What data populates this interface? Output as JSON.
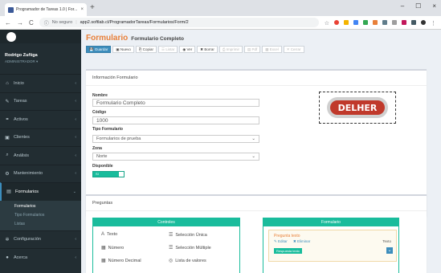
{
  "browser": {
    "tab_title": "Programador de Tareas 1.0 | For...",
    "tab_close": "×",
    "new_tab": "+",
    "window_controls": [
      "–",
      "☐",
      "×"
    ],
    "nav_back": "←",
    "nav_forward": "→",
    "nav_reload": "C",
    "secure_label": "No seguro",
    "url": "app2.softlab.cl/ProgramadorTareas/Formularios/Form/2"
  },
  "sidebar": {
    "user_name": "Rodrigo Zuñiga",
    "user_role": "ADMINISTRADOR ▾",
    "items": [
      {
        "label": "Inicio",
        "icon": "home-icon",
        "glyph": "⌂"
      },
      {
        "label": "Tareas",
        "icon": "wrench-icon",
        "glyph": "✎"
      },
      {
        "label": "Activos",
        "icon": "link-icon",
        "glyph": "⚭"
      },
      {
        "label": "Clientes",
        "icon": "building-icon",
        "glyph": "▣"
      },
      {
        "label": "Análisis",
        "icon": "search-icon",
        "glyph": "⌕"
      },
      {
        "label": "Mantenimiento",
        "icon": "tools-icon",
        "glyph": "⚙"
      },
      {
        "label": "Formularios",
        "icon": "form-icon",
        "glyph": "▤"
      },
      {
        "label": "Configuración",
        "icon": "gear-icon",
        "glyph": "✲"
      },
      {
        "label": "Acerca",
        "icon": "info-icon",
        "glyph": "●"
      }
    ],
    "subitems": [
      "Formularios",
      "Tipo Formularios",
      "Listas"
    ]
  },
  "page": {
    "title": "Formulario",
    "subtitle": "Formulario Completo"
  },
  "toolbar": [
    {
      "label": "Guardar",
      "state": "primary"
    },
    {
      "label": "Nuevo",
      "state": "normal"
    },
    {
      "label": "Copiar",
      "state": "normal"
    },
    {
      "label": "Listar",
      "state": "disabled"
    },
    {
      "label": "Ver",
      "state": "normal"
    },
    {
      "label": "Borrar",
      "state": "normal"
    },
    {
      "label": "Imprimir",
      "state": "disabled"
    },
    {
      "label": "Pdf",
      "state": "disabled"
    },
    {
      "label": "Excel",
      "state": "disabled"
    },
    {
      "label": "Cerrar",
      "state": "disabled"
    }
  ],
  "info_box": {
    "title": "Información Formulario",
    "nombre_label": "Nombre",
    "nombre_value": "Formulario Completo",
    "codigo_label": "Código",
    "codigo_value": "1000",
    "tipo_label": "Tipo Formulario",
    "tipo_value": "Formularios de prueba",
    "zona_label": "Zona",
    "zona_value": "Norte",
    "disponible_label": "Disponible",
    "disponible_value": "SI",
    "logo_text": "DELHER"
  },
  "preguntas_box": {
    "title": "Preguntas",
    "controles_header": "Controles",
    "formulario_header": "Formulario",
    "controls": [
      {
        "label": "Texto",
        "glyph": "A"
      },
      {
        "label": "Selección Única",
        "glyph": "☰"
      },
      {
        "label": "Número",
        "glyph": "▦"
      },
      {
        "label": "Selección Múltiple",
        "glyph": "☰"
      },
      {
        "label": "Número Decimal",
        "glyph": "▦"
      },
      {
        "label": "Lista de valores",
        "glyph": "◎"
      }
    ],
    "pregunta_title": "Pregunta texto",
    "pregunta_edit": "Editar",
    "pregunta_delete": "Eliminar",
    "pregunta_type": "Texto",
    "pregunta_badge": "Respuesta texto"
  },
  "colors": {
    "accent": "#e8803a",
    "primary": "#3c8dbc",
    "teal": "#1abc9c",
    "sidebar_bg": "#222d32"
  }
}
